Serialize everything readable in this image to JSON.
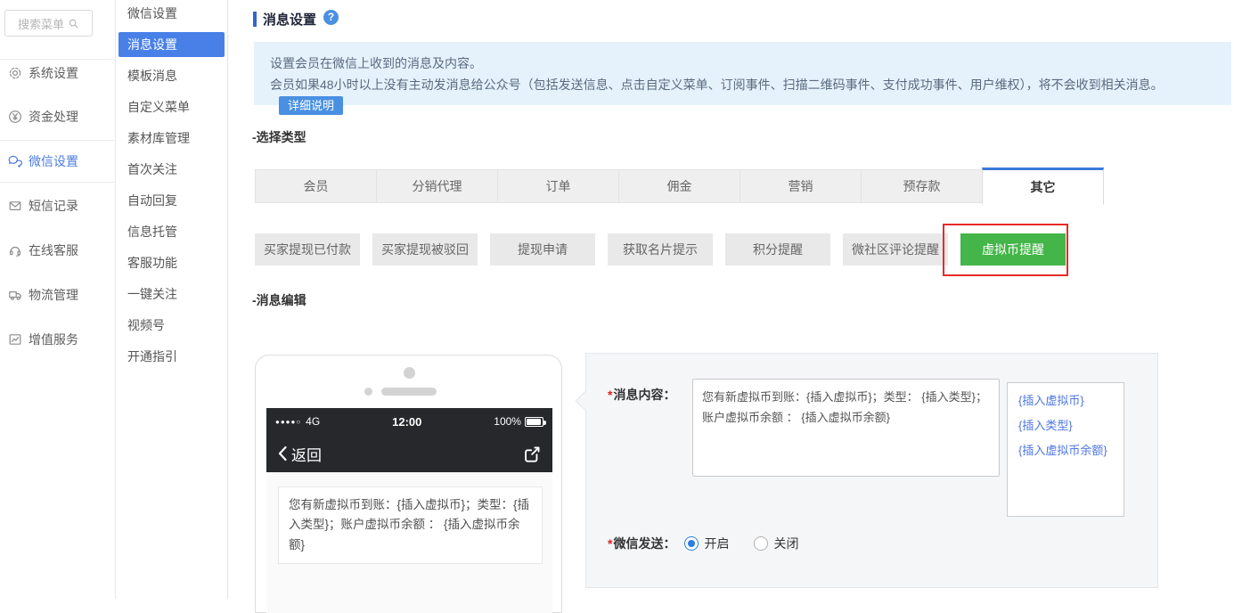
{
  "colors": {
    "accent_blue": "#4880e8",
    "title_bar_blue": "#3464d0",
    "notice_bg": "#e5f2fc",
    "detail_button_blue": "#4a90e2",
    "tab_active_border": "#3a7ad9",
    "active_green": "#44b549",
    "annotation_red": "#e62b2b",
    "link_blue": "#4f77e3"
  },
  "sidebar": {
    "search_placeholder": "搜索菜单",
    "search_icon": "magnifier-icon",
    "items": [
      {
        "label": "系统设置",
        "icon": "gear-icon",
        "active": false
      },
      {
        "label": "资金处理",
        "icon": "yen-icon",
        "active": false
      },
      {
        "label": "微信设置",
        "icon": "wechat-icon",
        "active": true
      },
      {
        "label": "短信记录",
        "icon": "mail-icon",
        "active": false
      },
      {
        "label": "在线客服",
        "icon": "headset-icon",
        "active": false
      },
      {
        "label": "物流管理",
        "icon": "truck-icon",
        "active": false
      },
      {
        "label": "增值服务",
        "icon": "chart-icon",
        "active": false
      }
    ]
  },
  "submenu": {
    "items": [
      {
        "label": "微信设置",
        "active": false
      },
      {
        "label": "消息设置",
        "active": true
      },
      {
        "label": "模板消息",
        "active": false
      },
      {
        "label": "自定义菜单",
        "active": false
      },
      {
        "label": "素材库管理",
        "active": false
      },
      {
        "label": "首次关注",
        "active": false
      },
      {
        "label": "自动回复",
        "active": false
      },
      {
        "label": "信息托管",
        "active": false
      },
      {
        "label": "客服功能",
        "active": false
      },
      {
        "label": "一键关注",
        "active": false
      },
      {
        "label": "视频号",
        "active": false
      },
      {
        "label": "开通指引",
        "active": false
      }
    ]
  },
  "main": {
    "page_title": "消息设置",
    "help_mark": "?",
    "notice": {
      "line1": "设置会员在微信上收到的消息及内容。",
      "line2": "会员如果48小时以上没有主动发消息给公众号（包括发送信息、点击自定义菜单、订阅事件、扫描二维码事件、支付成功事件、用户维权），将不会收到相关消息。",
      "button_label": "详细说明"
    },
    "section_select_type": "-选择类型",
    "tabs": [
      {
        "label": "会员",
        "active": false
      },
      {
        "label": "分销代理",
        "active": false
      },
      {
        "label": "订单",
        "active": false
      },
      {
        "label": "佣金",
        "active": false
      },
      {
        "label": "营销",
        "active": false
      },
      {
        "label": "预存款",
        "active": false
      },
      {
        "label": "其它",
        "active": true
      }
    ],
    "subtypes": [
      {
        "label": "买家提现已付款",
        "active": false
      },
      {
        "label": "买家提现被驳回",
        "active": false
      },
      {
        "label": "提现申请",
        "active": false
      },
      {
        "label": "获取名片提示",
        "active": false
      },
      {
        "label": "积分提醒",
        "active": false
      },
      {
        "label": "微社区评论提醒",
        "active": false
      },
      {
        "label": "虚拟币提醒",
        "active": true,
        "annotated": "red-box"
      }
    ],
    "section_message_edit": "-消息编辑"
  },
  "phone": {
    "status": {
      "signal": "●●●●○",
      "network": "4G",
      "time": "12:00",
      "battery": "100%"
    },
    "nav_back_label": "返回",
    "share_icon": "share-icon",
    "message_preview": "您有新虚拟币到账：{插入虚拟币}；类型：{插入类型}；账户虚拟币余额 ： {插入虚拟币余额}"
  },
  "form": {
    "required_mark": "*",
    "content_label": "消息内容：",
    "content_value": "您有新虚拟币到账：{插入虚拟币}；类型： {插入类型}；账户虚拟币余额 ： {插入虚拟币余额}",
    "insert_links": [
      "{插入虚拟币}",
      "{插入类型}",
      "{插入虚拟币余额}"
    ],
    "send_label": "微信发送：",
    "radio_on_label": "开启",
    "radio_off_label": "关闭",
    "selected": "开启"
  }
}
